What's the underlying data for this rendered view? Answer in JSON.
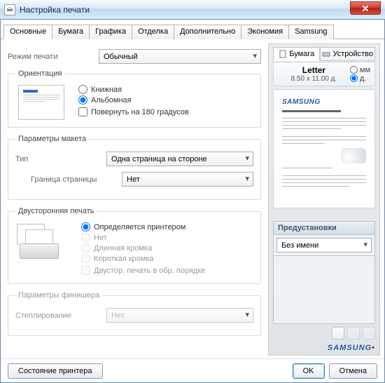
{
  "window": {
    "title": "Настройка печати"
  },
  "tabs": [
    "Основные",
    "Бумага",
    "Графика",
    "Отделка",
    "Дополнительно",
    "Экономия",
    "Samsung"
  ],
  "active_tab": 0,
  "print_mode": {
    "label": "Режим печати",
    "value": "Обычный"
  },
  "orientation": {
    "legend": "Ориентация",
    "portrait": "Книжная",
    "landscape": "Альбомная",
    "rotate180": "Повернуть на 180 градусов",
    "selected": "landscape"
  },
  "layout": {
    "legend": "Параметры макета",
    "type_label": "Тип",
    "type_value": "Одна страница на стороне",
    "border_label": "Граница страницы",
    "border_value": "Нет"
  },
  "duplex": {
    "legend": "Двусторонняя печать",
    "opt_printer": "Определяется принтером",
    "opt_none": "Нет",
    "opt_long": "Длинная кромка",
    "opt_short": "Короткая кромка",
    "reverse": "Двустор. печать в обр. порядке",
    "selected": "printer"
  },
  "finisher": {
    "legend": "Параметры финишера",
    "stapling_label": "Степлирование",
    "stapling_value": "Нет"
  },
  "right": {
    "tab_paper": "Бумага",
    "tab_device": "Устройство",
    "paper_name": "Letter",
    "paper_dim": "8.50 x 11.00 д.",
    "unit_mm": "мм",
    "unit_in": "д.",
    "unit_selected": "in",
    "presets_label": "Предустановки",
    "preset_value": "Без имени",
    "brand": "SAMSUNG"
  },
  "footer": {
    "printer_status": "Состояние принтера",
    "ok": "OK",
    "cancel": "Отмена"
  }
}
